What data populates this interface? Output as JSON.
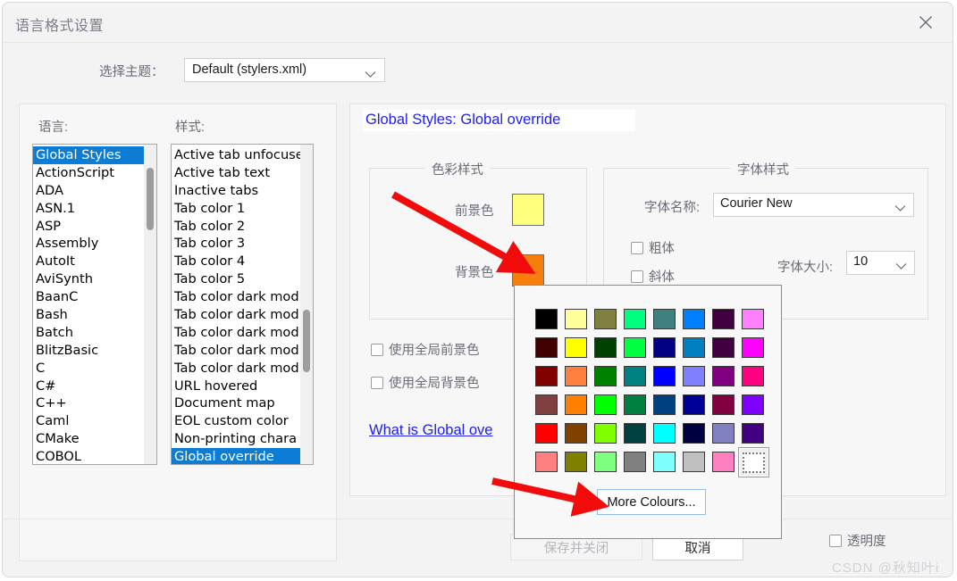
{
  "window": {
    "title": "语言格式设置",
    "close_icon": "close-icon"
  },
  "theme": {
    "label": "选择主题：",
    "value": "Default (stylers.xml)",
    "chevron_icon": "chevron-down-icon"
  },
  "lists": {
    "language_label": "语言:",
    "style_label": "样式:",
    "languages": [
      "Global Styles",
      "ActionScript",
      "ADA",
      "ASN.1",
      "ASP",
      "Assembly",
      "AutoIt",
      "AviSynth",
      "BaanC",
      "Bash",
      "Batch",
      "BlitzBasic",
      "C",
      "C#",
      "C++",
      "Caml",
      "CMake",
      "COBOL"
    ],
    "language_selected": "Global Styles",
    "styles": [
      "Active tab unfocuse",
      "Active tab text",
      "Inactive tabs",
      "Tab color 1",
      "Tab color 2",
      "Tab color 3",
      "Tab color 4",
      "Tab color 5",
      "Tab color dark mod",
      "Tab color dark mod",
      "Tab color dark mod",
      "Tab color dark mod",
      "Tab color dark mod",
      "URL hovered",
      "Document map",
      "EOL custom color",
      "Non-printing chara",
      "Global override"
    ],
    "style_selected": "Global override"
  },
  "detail": {
    "title": "Global Styles: Global override",
    "color_group_legend": "色彩样式",
    "foreground_label": "前景色",
    "foreground_color": "#ffff80",
    "background_label": "背景色",
    "background_color": "#f57f0c",
    "use_global_fg_label": "使用全局前景色",
    "use_global_bg_label": "使用全局背景色",
    "help_link": "What is Global ove",
    "font_group_legend": "字体样式",
    "font_name_label": "字体名称:",
    "font_name_value": "Courier New",
    "bold_label": "粗体",
    "italic_label": "斜体",
    "font_size_label": "字体大小:",
    "font_size_value": "10"
  },
  "picker": {
    "more_colours_label": "More Colours...",
    "selected_index": 47,
    "colors": [
      "#000000",
      "#ffff99",
      "#808040",
      "#00ff80",
      "#408080",
      "#0080ff",
      "#400040",
      "#ff80ff",
      "#400000",
      "#ffff00",
      "#004000",
      "#00ff40",
      "#000080",
      "#0080c0",
      "#400040",
      "#ff00ff",
      "#800000",
      "#ff8040",
      "#008000",
      "#008080",
      "#0000ff",
      "#8080ff",
      "#800080",
      "#ff0080",
      "#804040",
      "#ff8000",
      "#00ff00",
      "#008040",
      "#004080",
      "#000099",
      "#800040",
      "#8000ff",
      "#ff0000",
      "#804000",
      "#80ff00",
      "#004040",
      "#00ffff",
      "#000040",
      "#8080c0",
      "#400080",
      "#ff8080",
      "#808000",
      "#80ff80",
      "#808080",
      "#80ffff",
      "#c0c0c0",
      "#ff80c0",
      "#ffffff"
    ]
  },
  "footer": {
    "save_close_label": "保存并关闭",
    "cancel_label": "取消",
    "transparency_label": "透明度",
    "watermark": "CSDN @秋知叶i"
  }
}
